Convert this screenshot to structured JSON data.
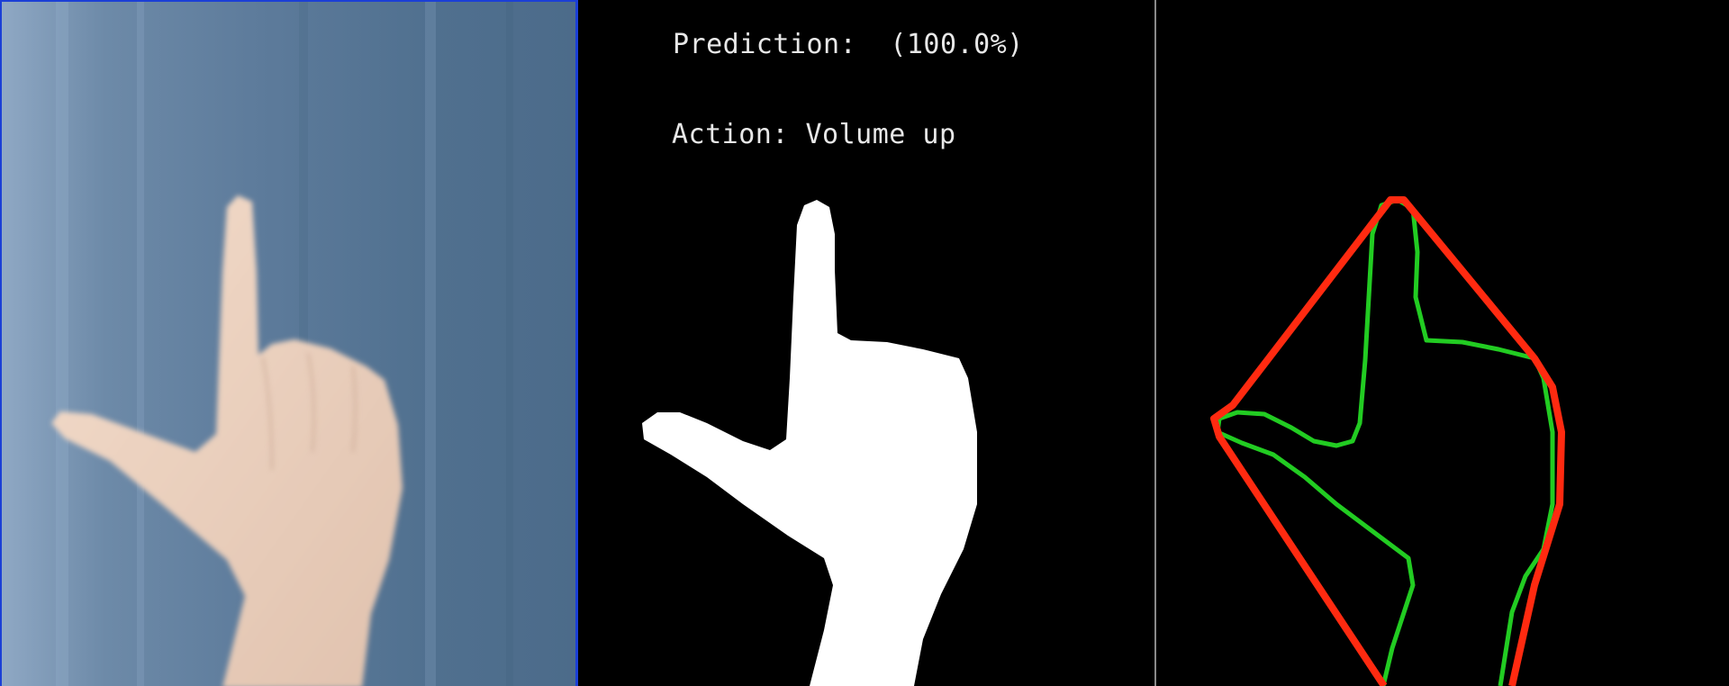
{
  "prediction": {
    "label": "Prediction:",
    "value": "(100.0%)"
  },
  "action": {
    "label": "Action:",
    "value": "Volume up"
  },
  "colors": {
    "border_blue": "#1b3fd6",
    "hull_red": "#ff2a10",
    "contour_green": "#22cc22",
    "mask_white": "#ffffff"
  }
}
